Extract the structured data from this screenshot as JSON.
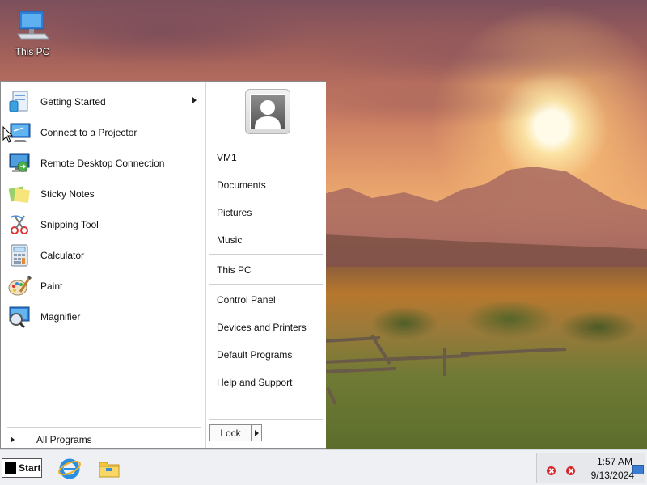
{
  "desktop": {
    "icons": [
      {
        "label": "This PC",
        "icon": "this-pc-icon"
      }
    ]
  },
  "start_menu": {
    "programs": [
      {
        "label": "Getting Started",
        "icon": "getting-started-icon",
        "has_submenu": true
      },
      {
        "label": "Connect to a Projector",
        "icon": "projector-icon",
        "has_submenu": false
      },
      {
        "label": "Remote Desktop Connection",
        "icon": "remote-desktop-icon",
        "has_submenu": false
      },
      {
        "label": "Sticky Notes",
        "icon": "sticky-notes-icon",
        "has_submenu": false
      },
      {
        "label": "Snipping Tool",
        "icon": "snipping-tool-icon",
        "has_submenu": false
      },
      {
        "label": "Calculator",
        "icon": "calculator-icon",
        "has_submenu": false
      },
      {
        "label": "Paint",
        "icon": "paint-icon",
        "has_submenu": false
      },
      {
        "label": "Magnifier",
        "icon": "magnifier-icon",
        "has_submenu": false
      }
    ],
    "all_programs_label": "All Programs",
    "right_links": {
      "user": "VM1",
      "documents": "Documents",
      "pictures": "Pictures",
      "music": "Music",
      "this_pc": "This PC",
      "control_panel": "Control Panel",
      "devices_printers": "Devices and Printers",
      "default_programs": "Default Programs",
      "help_support": "Help and Support"
    },
    "lock_label": "Lock"
  },
  "taskbar": {
    "start_label": "Start",
    "pinned": [
      {
        "name": "internet-explorer-icon"
      },
      {
        "name": "file-explorer-icon"
      }
    ],
    "clock": {
      "time": "1:57 AM",
      "date": "9/13/2024"
    }
  },
  "colors": {
    "tray_error": "#d9262b",
    "notification": "#3a7dd0"
  }
}
